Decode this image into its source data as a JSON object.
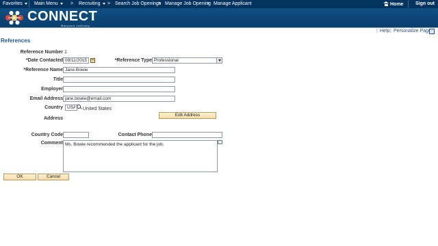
{
  "topnav": {
    "favorites": "Favorites",
    "main_menu": "Main Menu",
    "breadcrumb_sep": ">",
    "recruiting": "Recruiting",
    "search_job_openings": "Search Job Openings",
    "manage_job_opening": "Manage Job Opening",
    "manage_applicant": "Manage Applicant",
    "home": "Home",
    "sign_out": "Sign out"
  },
  "banner": {
    "brand": "CONNECT",
    "subtitle": "Maryland Judiciary"
  },
  "utility": {
    "bar": "|",
    "help": "Help",
    "personalize": "Personalize Page"
  },
  "page": {
    "title": "References"
  },
  "form": {
    "reference_number_label": "Reference Number",
    "reference_number_value": "1",
    "date_contacted_label": "*Date Contacted",
    "date_contacted_value": "09/11/2015",
    "reference_type_label": "*Reference Type",
    "reference_type_value": "Professional",
    "reference_name_label": "*Reference Name",
    "reference_name_value": "Jane Bowie",
    "title_label": "Title",
    "title_value": "",
    "employer_label": "Employer",
    "employer_value": "",
    "email_label": "Email Address",
    "email_value": "jane.bowie@email.com",
    "country_label": "Country",
    "country_code_value": "USA",
    "country_name": "United States",
    "address_label": "Address",
    "edit_address_button": "Edit Address",
    "phone_country_code_label": "Country Code",
    "phone_country_code_value": "",
    "contact_phone_label": "Contact Phone",
    "contact_phone_value": "",
    "comment_label": "Comment",
    "comment_value": "Ms. Bowie recommended the applicant for the job."
  },
  "actions": {
    "ok": "OK",
    "cancel": "Cancel"
  },
  "colors": {
    "nav_bg": "#05335f",
    "banner_bg": "#0f4e82",
    "title_blue": "#1f5a94",
    "button_bg": "#f5dcaa"
  }
}
